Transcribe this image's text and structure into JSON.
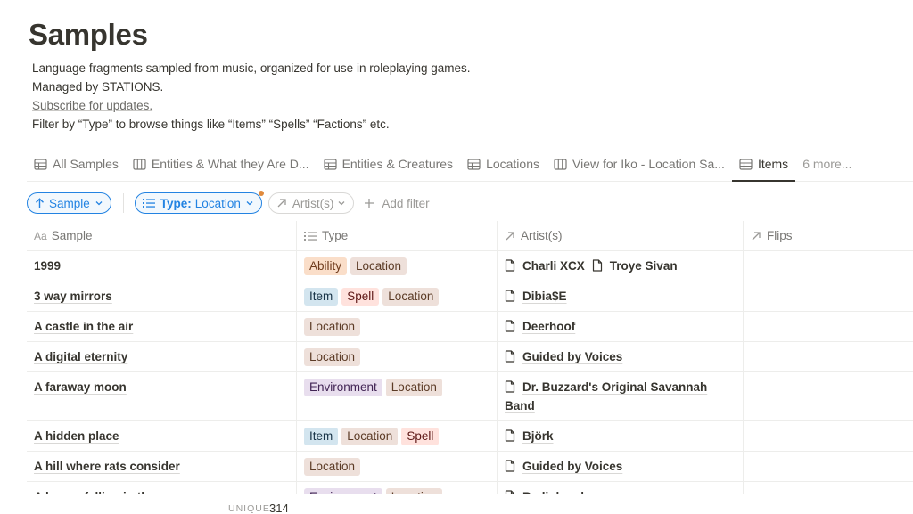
{
  "page": {
    "title": "Samples",
    "description": [
      "Language fragments sampled from music, organized for use in roleplaying games.",
      "Managed by STATIONS.",
      "Subscribe for updates.",
      "Filter by “Type” to browse things like “Items” “Spells” “Factions” etc."
    ]
  },
  "tabs": [
    {
      "label": "All Samples",
      "icon": "table-icon"
    },
    {
      "label": "Entities & What they Are D...",
      "icon": "board-icon"
    },
    {
      "label": "Entities & Creatures",
      "icon": "table-icon"
    },
    {
      "label": "Locations",
      "icon": "table-icon"
    },
    {
      "label": "View for Iko - Location Sa...",
      "icon": "board-icon"
    },
    {
      "label": "Items",
      "icon": "table-icon",
      "active": true
    }
  ],
  "more_tabs": "6 more...",
  "filters": {
    "sort": "Sample",
    "type_label": "Type:",
    "type_value": "Location",
    "artist": "Artist(s)",
    "add": "Add filter"
  },
  "columns": [
    "Sample",
    "Type",
    "Artist(s)",
    "Flips"
  ],
  "tag_colors": {
    "Ability": {
      "bg": "#fadec9",
      "fg": "#6f3b1c"
    },
    "Location": {
      "bg": "#eee0da",
      "fg": "#5c3b26"
    },
    "Item": {
      "bg": "#d3e5ef",
      "fg": "#183347"
    },
    "Spell": {
      "bg": "#ffe2dd",
      "fg": "#5d1715"
    },
    "Environment": {
      "bg": "#e8deee",
      "fg": "#412454"
    }
  },
  "rows": [
    {
      "sample": "1999",
      "types": [
        "Ability",
        "Location"
      ],
      "artists": [
        "Charli XCX",
        "Troye Sivan"
      ]
    },
    {
      "sample": "3 way mirrors",
      "types": [
        "Item",
        "Spell",
        "Location"
      ],
      "artists": [
        "Dibia$E"
      ]
    },
    {
      "sample": "A castle in the air",
      "types": [
        "Location"
      ],
      "artists": [
        "Deerhoof"
      ]
    },
    {
      "sample": "A digital eternity",
      "types": [
        "Location"
      ],
      "artists": [
        "Guided by Voices"
      ]
    },
    {
      "sample": "A faraway moon",
      "types": [
        "Environment",
        "Location"
      ],
      "artists": [
        "Dr. Buzzard's Original Savannah Band"
      ]
    },
    {
      "sample": "A hidden place",
      "types": [
        "Item",
        "Location",
        "Spell"
      ],
      "artists": [
        "Björk"
      ]
    },
    {
      "sample": "A hill where rats consider",
      "types": [
        "Location"
      ],
      "artists": [
        "Guided by Voices"
      ]
    },
    {
      "sample": "A house falling in the sea",
      "types": [
        "Environment",
        "Location"
      ],
      "artists": [
        "Radiohead"
      ]
    }
  ],
  "footer": {
    "label": "UNIQUE",
    "value": "314"
  }
}
